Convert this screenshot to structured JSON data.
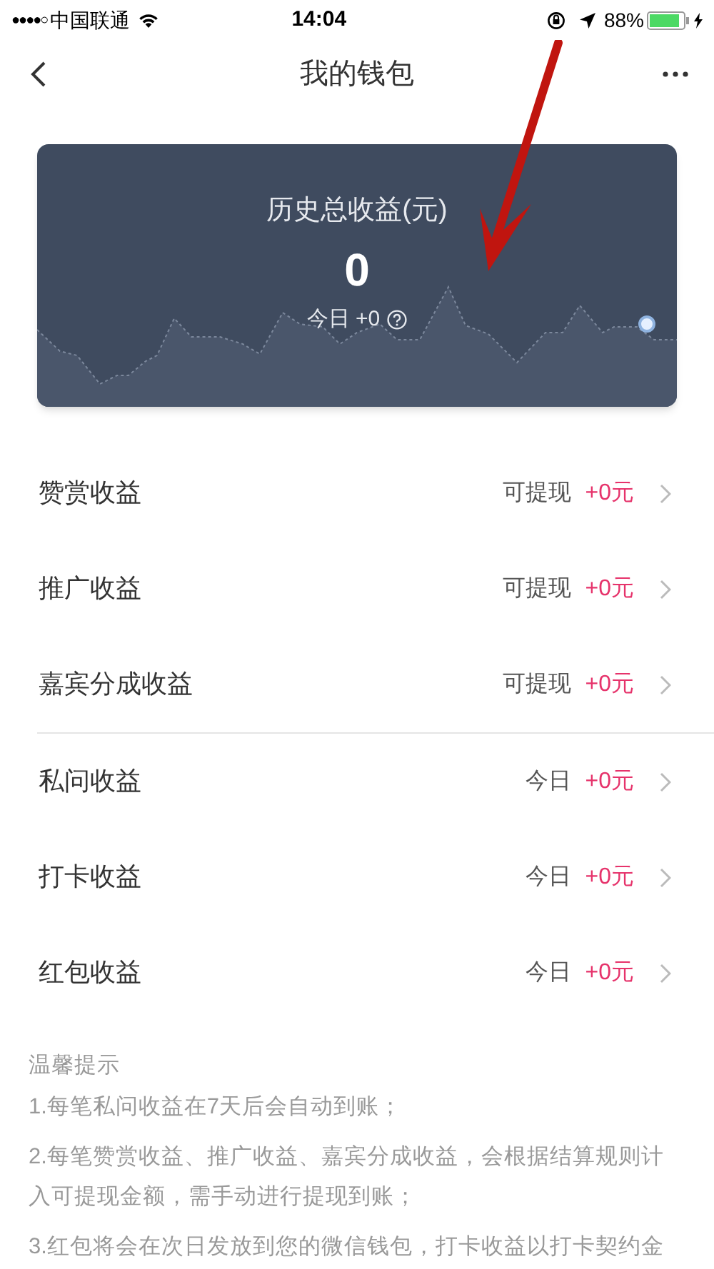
{
  "status_bar": {
    "signal": "●●●●○",
    "carrier": "中国联通",
    "time": "14:04",
    "battery": "88%"
  },
  "nav": {
    "title": "我的钱包"
  },
  "summary": {
    "label": "历史总收益(元)",
    "total": "0",
    "today": "今日 +0"
  },
  "groups": [
    [
      {
        "name": "赞赏收益",
        "status": "可提现",
        "amount": "+0元"
      },
      {
        "name": "推广收益",
        "status": "可提现",
        "amount": "+0元"
      },
      {
        "name": "嘉宾分成收益",
        "status": "可提现",
        "amount": "+0元"
      }
    ],
    [
      {
        "name": "私问收益",
        "status": "今日",
        "amount": "+0元"
      },
      {
        "name": "打卡收益",
        "status": "今日",
        "amount": "+0元"
      },
      {
        "name": "红包收益",
        "status": "今日",
        "amount": "+0元"
      }
    ]
  ],
  "tips": {
    "title": "温馨提示",
    "lines": [
      "1.每笔私问收益在7天后会自动到账；",
      "2.每笔赞赏收益、推广收益、嘉宾分成收益，会根据结算规则计入可提现金额，需手动进行提现到账；",
      "3.红包将会在次日发放到您的微信钱包，打卡收益以打卡契约金"
    ]
  }
}
